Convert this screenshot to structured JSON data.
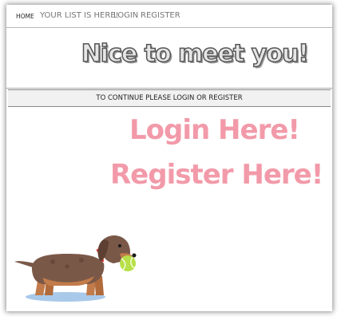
{
  "nav": {
    "home": "HOME",
    "list": "YOUR LIST IS HERE!",
    "login": "LOGIN",
    "register": "REGISTER"
  },
  "hero": {
    "title": "Nice to meet you!"
  },
  "banner": {
    "text": "TO CONTINUE PLEASE LOGIN OR REGISTER"
  },
  "links": {
    "login": "Login Here!",
    "register": "Register Here!"
  },
  "colors": {
    "link": "#f29aa9",
    "dog_body": "#7a5848",
    "dog_belly": "#c27b4a",
    "ball": "#b7e04a",
    "collar": "#d83a3a",
    "shadow": "#a9c9ea"
  },
  "icons": {
    "illustration": "dachshund-with-ball-illustration"
  }
}
